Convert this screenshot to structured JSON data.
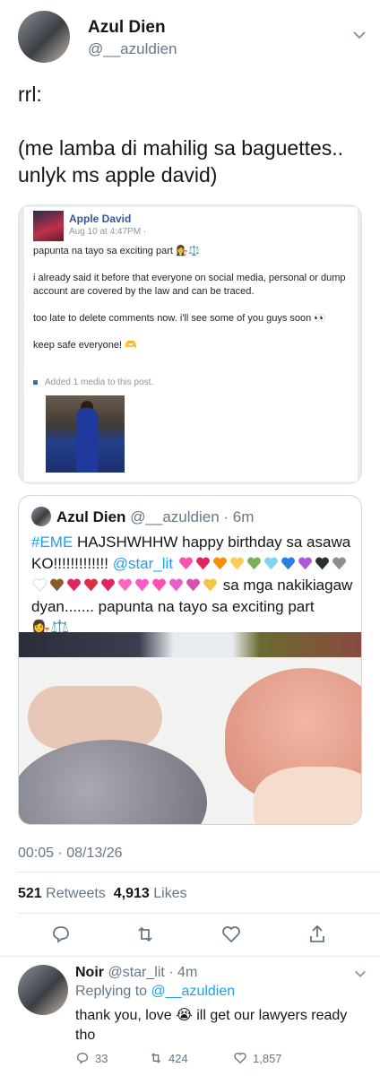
{
  "header": {
    "display_name": "Azul Dien",
    "handle": "@__azuldien"
  },
  "tweet": {
    "line1": "rrl:",
    "line2": "(me lamba di mahilig sa baguettes.. unlyk ms apple david)"
  },
  "fb_post": {
    "author": "Apple David",
    "date": "Aug 10 at 4:47PM",
    "p1": "papunta na tayo sa exciting part",
    "p2": "i already said it before that everyone on social media, personal or dump account are covered by the law and can be traced.",
    "p3": "too late to delete comments now. i'll see some of you guys soon",
    "p4": "keep safe everyone!",
    "media_note": "Added 1 media to this post."
  },
  "quote": {
    "display_name": "Azul Dien",
    "handle": "@__azuldien",
    "time": "6m",
    "hashtag": "#EME",
    "text1": "HAJSHWHHW happy birthday sa asawa KO!!!!!!!!!!!!!",
    "mention": "@star_lit",
    "text2": "sa mga nakikiagaw dyan....... papunta na tayo sa exciting part"
  },
  "meta": {
    "timestamp": "00:05 · 08/13/26",
    "retweets_count": "521",
    "retweets_label": "Retweets",
    "likes_count": "4,913",
    "likes_label": "Likes"
  },
  "reply": {
    "display_name": "Noir",
    "handle": "@star_lit",
    "time": "4m",
    "replying_prefix": "Replying to",
    "replying_to": "@__azuldien",
    "text1": "thank you, love",
    "text2": "ill get our lawyers ready tho",
    "reply_count": "33",
    "retweet_count": "424",
    "like_count": "1,857"
  },
  "colors": {
    "accent": "#1da1f2",
    "muted": "#657786",
    "fb_blue": "#365899"
  },
  "icons": [
    "chevron-down-icon",
    "reply-icon",
    "retweet-icon",
    "like-icon",
    "share-icon",
    "scales-icon",
    "eyes-icon",
    "heart-hands-icon",
    "crying-icon"
  ]
}
